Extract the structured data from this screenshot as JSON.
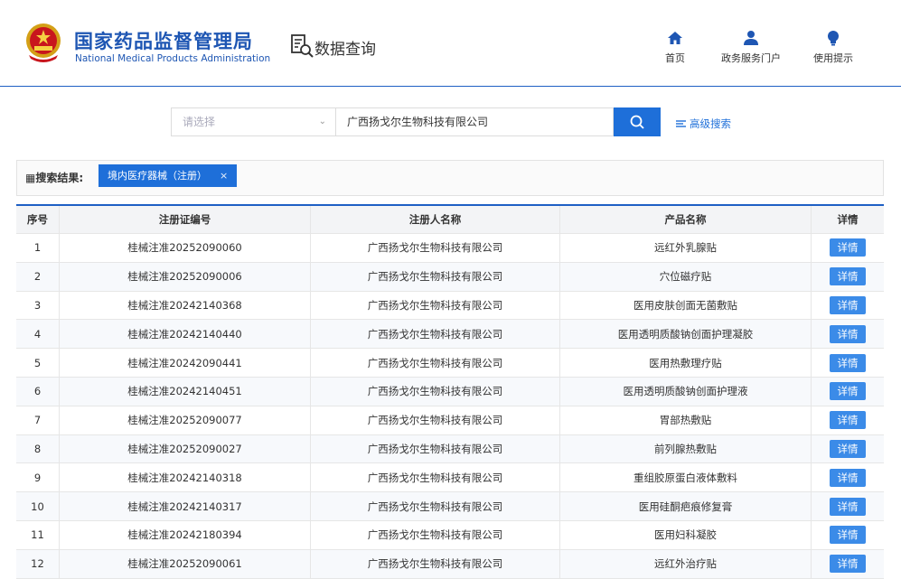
{
  "header": {
    "org_name_cn": "国家药品监督管理局",
    "org_name_en": "National Medical Products Administration",
    "section_title": "数据查询",
    "nav": [
      {
        "label": "首页",
        "icon": "home-icon"
      },
      {
        "label": "政务服务门户",
        "icon": "user-icon"
      },
      {
        "label": "使用提示",
        "icon": "lightbulb-icon"
      }
    ]
  },
  "search": {
    "select_placeholder": "请选择",
    "keyword": "广西扬戈尔生物科技有限公司",
    "advanced_label": "高级搜索"
  },
  "results": {
    "label": "搜索结果:",
    "filter_chip": "境内医疗器械（注册）",
    "columns": [
      "序号",
      "注册证编号",
      "注册人名称",
      "产品名称",
      "详情"
    ],
    "detail_label": "详情",
    "rows": [
      {
        "no": "1",
        "cert": "桂械注准20252090060",
        "registrant": "广西扬戈尔生物科技有限公司",
        "product": "远红外乳腺贴"
      },
      {
        "no": "2",
        "cert": "桂械注准20252090006",
        "registrant": "广西扬戈尔生物科技有限公司",
        "product": "穴位磁疗贴"
      },
      {
        "no": "3",
        "cert": "桂械注准20242140368",
        "registrant": "广西扬戈尔生物科技有限公司",
        "product": "医用皮肤创面无菌敷贴"
      },
      {
        "no": "4",
        "cert": "桂械注准20242140440",
        "registrant": "广西扬戈尔生物科技有限公司",
        "product": "医用透明质酸钠创面护理凝胶"
      },
      {
        "no": "5",
        "cert": "桂械注准20242090441",
        "registrant": "广西扬戈尔生物科技有限公司",
        "product": "医用热敷理疗贴"
      },
      {
        "no": "6",
        "cert": "桂械注准20242140451",
        "registrant": "广西扬戈尔生物科技有限公司",
        "product": "医用透明质酸钠创面护理液"
      },
      {
        "no": "7",
        "cert": "桂械注准20252090077",
        "registrant": "广西扬戈尔生物科技有限公司",
        "product": "胃部热敷贴"
      },
      {
        "no": "8",
        "cert": "桂械注准20252090027",
        "registrant": "广西扬戈尔生物科技有限公司",
        "product": "前列腺热敷贴"
      },
      {
        "no": "9",
        "cert": "桂械注准20242140318",
        "registrant": "广西扬戈尔生物科技有限公司",
        "product": "重组胶原蛋白液体敷料"
      },
      {
        "no": "10",
        "cert": "桂械注准20242140317",
        "registrant": "广西扬戈尔生物科技有限公司",
        "product": "医用硅酮疤痕修复膏"
      },
      {
        "no": "11",
        "cert": "桂械注准20242180394",
        "registrant": "广西扬戈尔生物科技有限公司",
        "product": "医用妇科凝胶"
      },
      {
        "no": "12",
        "cert": "桂械注准20252090061",
        "registrant": "广西扬戈尔生物科技有限公司",
        "product": "远红外治疗贴"
      }
    ]
  },
  "colors": {
    "primary": "#1e6fd9",
    "brand": "#1e56b3",
    "detail_button": "#3b8be8"
  }
}
